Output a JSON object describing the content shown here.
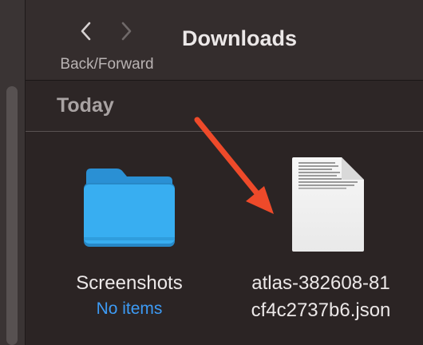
{
  "toolbar": {
    "back_icon": "chevron-left-icon",
    "forward_icon": "chevron-right-icon",
    "nav_label": "Back/Forward",
    "title": "Downloads"
  },
  "section": {
    "title": "Today"
  },
  "items": [
    {
      "name": "Screenshots",
      "subtitle": "No items",
      "icon": "folder-icon"
    },
    {
      "name_line1": "atlas-382608-81",
      "name_line2": "cf4c2737b6.json",
      "icon": "json-file-icon"
    }
  ],
  "annotation": {
    "icon": "red-arrow-icon",
    "color": "#ee4a2a"
  },
  "colors": {
    "folder": "#35aef0",
    "link": "#3d9bf5",
    "background": "#2b2424"
  }
}
